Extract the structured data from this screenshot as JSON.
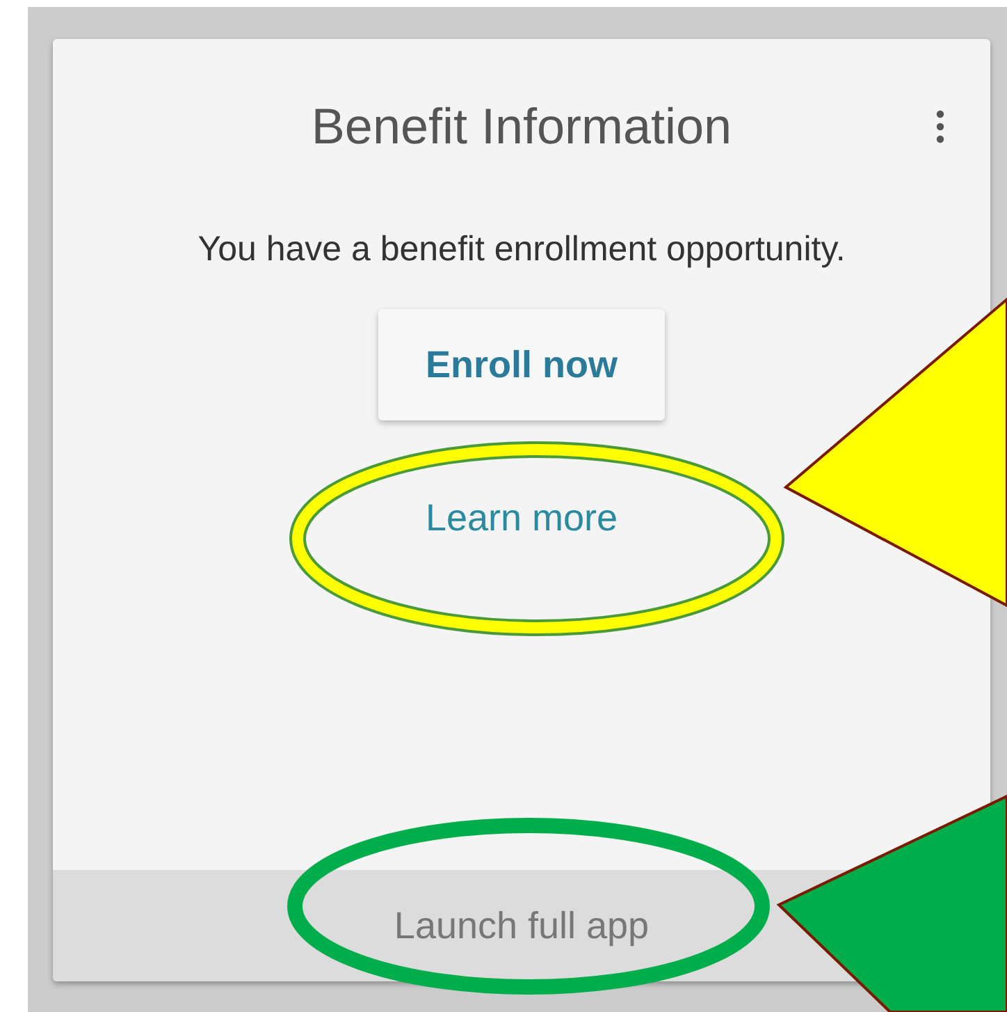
{
  "card": {
    "title": "Benefit Information",
    "message": "You have a benefit enrollment opportunity.",
    "primary_button": "Enroll now",
    "link": "Learn more",
    "footer_button": "Launch full app"
  }
}
